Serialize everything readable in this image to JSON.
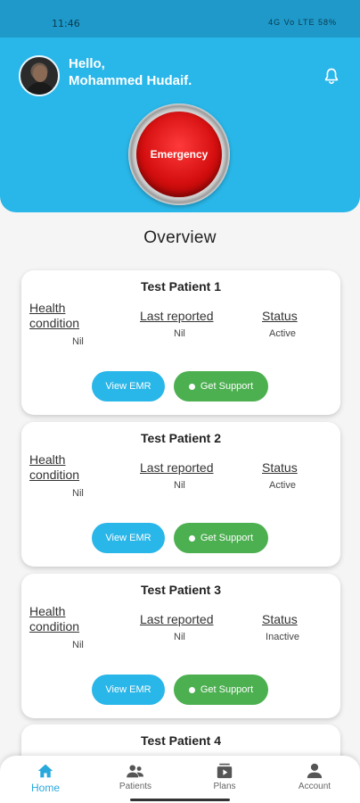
{
  "status_bar": {
    "time": "11:46",
    "indicators": "4G Vo LTE 58%"
  },
  "header": {
    "greeting_line1": "Hello,",
    "greeting_line2": "Mohammed Hudaif.",
    "emergency_label": "Emergency",
    "colors": {
      "header_bg": "#29b6e8",
      "emergency_red": "#d50f0f"
    }
  },
  "overview": {
    "title": "Overview"
  },
  "column_labels": {
    "health": "Health condition",
    "last": "Last reported",
    "status": "Status"
  },
  "buttons": {
    "view_emr": "View EMR",
    "get_support": "Get Support"
  },
  "patients": [
    {
      "name": "Test Patient 1",
      "health": "Nil",
      "last": "Nil",
      "status": "Active"
    },
    {
      "name": "Test Patient 2",
      "health": "Nil",
      "last": "Nil",
      "status": "Active"
    },
    {
      "name": "Test Patient 3",
      "health": "Nil",
      "last": "Nil",
      "status": "Inactive"
    },
    {
      "name": "Test Patient 4"
    }
  ],
  "nav": {
    "items": [
      {
        "label": "Home",
        "icon": "home-icon",
        "active": true
      },
      {
        "label": "Patients",
        "icon": "patients-icon"
      },
      {
        "label": "Plans",
        "icon": "plans-icon"
      },
      {
        "label": "Account",
        "icon": "account-icon"
      }
    ],
    "colors": {
      "active": "#29a8dc",
      "support_green": "#4caf50"
    }
  }
}
